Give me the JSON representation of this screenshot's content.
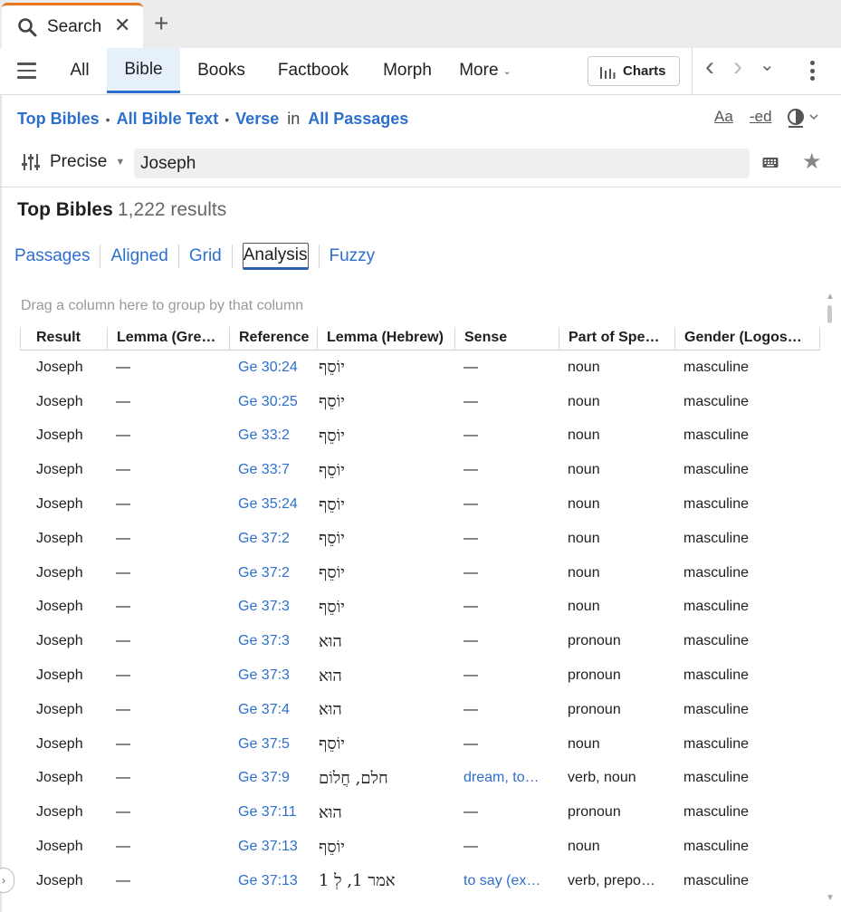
{
  "tab": {
    "title": "Search",
    "close": "✕",
    "new_tab": "+"
  },
  "toolbar": {
    "tabs": [
      {
        "label": "All",
        "active": false
      },
      {
        "label": "Bible",
        "active": true
      },
      {
        "label": "Books",
        "active": false
      },
      {
        "label": "Factbook",
        "active": false
      },
      {
        "label": "Morph",
        "active": false
      },
      {
        "label": "More",
        "active": false
      }
    ],
    "charts_label": "Charts",
    "back": "‹",
    "forward": "›",
    "history_chevron": "⌄"
  },
  "scope": {
    "bibles": "Top Bibles",
    "text": "All Bible Text",
    "unit": "Verse",
    "in": "in",
    "range": "All Passages",
    "dot": "•"
  },
  "tools": {
    "font": "Aa",
    "ed": "-ed"
  },
  "search": {
    "mode": "Precise",
    "query": "Joseph"
  },
  "results": {
    "title": "Top Bibles",
    "count": "1,222 results"
  },
  "views": [
    "Passages",
    "Aligned",
    "Grid",
    "Analysis",
    "Fuzzy"
  ],
  "active_view": "Analysis",
  "group_hint": "Drag a column here to group by that column",
  "columns": [
    "Result",
    "Lemma (Gre…",
    "Reference",
    "Lemma (Hebrew)",
    "Sense",
    "Part of Spe…",
    "Gender (Logos…"
  ],
  "rows": [
    {
      "result": "Joseph",
      "greek": "—",
      "ref": "Ge 30:24",
      "hebrew": "יוֹסֵף",
      "sense": "—",
      "sense_link": false,
      "pos": "noun",
      "gender": "masculine"
    },
    {
      "result": "Joseph",
      "greek": "—",
      "ref": "Ge 30:25",
      "hebrew": "יוֹסֵף",
      "sense": "—",
      "sense_link": false,
      "pos": "noun",
      "gender": "masculine"
    },
    {
      "result": "Joseph",
      "greek": "—",
      "ref": "Ge 33:2",
      "hebrew": "יוֹסֵף",
      "sense": "—",
      "sense_link": false,
      "pos": "noun",
      "gender": "masculine"
    },
    {
      "result": "Joseph",
      "greek": "—",
      "ref": "Ge 33:7",
      "hebrew": "יוֹסֵף",
      "sense": "—",
      "sense_link": false,
      "pos": "noun",
      "gender": "masculine"
    },
    {
      "result": "Joseph",
      "greek": "—",
      "ref": "Ge 35:24",
      "hebrew": "יוֹסֵף",
      "sense": "—",
      "sense_link": false,
      "pos": "noun",
      "gender": "masculine"
    },
    {
      "result": "Joseph",
      "greek": "—",
      "ref": "Ge 37:2",
      "hebrew": "יוֹסֵף",
      "sense": "—",
      "sense_link": false,
      "pos": "noun",
      "gender": "masculine"
    },
    {
      "result": "Joseph",
      "greek": "—",
      "ref": "Ge 37:2",
      "hebrew": "יוֹסֵף",
      "sense": "—",
      "sense_link": false,
      "pos": "noun",
      "gender": "masculine"
    },
    {
      "result": "Joseph",
      "greek": "—",
      "ref": "Ge 37:3",
      "hebrew": "יוֹסֵף",
      "sense": "—",
      "sense_link": false,
      "pos": "noun",
      "gender": "masculine"
    },
    {
      "result": "Joseph",
      "greek": "—",
      "ref": "Ge 37:3",
      "hebrew": "הוּא",
      "sense": "—",
      "sense_link": false,
      "pos": "pronoun",
      "gender": "masculine"
    },
    {
      "result": "Joseph",
      "greek": "—",
      "ref": "Ge 37:3",
      "hebrew": "הוּא",
      "sense": "—",
      "sense_link": false,
      "pos": "pronoun",
      "gender": "masculine"
    },
    {
      "result": "Joseph",
      "greek": "—",
      "ref": "Ge 37:4",
      "hebrew": "הוּא",
      "sense": "—",
      "sense_link": false,
      "pos": "pronoun",
      "gender": "masculine"
    },
    {
      "result": "Joseph",
      "greek": "—",
      "ref": "Ge 37:5",
      "hebrew": "יוֹסֵף",
      "sense": "—",
      "sense_link": false,
      "pos": "noun",
      "gender": "masculine"
    },
    {
      "result": "Joseph",
      "greek": "—",
      "ref": "Ge 37:9",
      "hebrew": "חלם, חֲלוֹם",
      "sense": "dream, to…",
      "sense_link": true,
      "pos": "verb, noun",
      "gender": "masculine"
    },
    {
      "result": "Joseph",
      "greek": "—",
      "ref": "Ge 37:11",
      "hebrew": "הוּא",
      "sense": "—",
      "sense_link": false,
      "pos": "pronoun",
      "gender": "masculine"
    },
    {
      "result": "Joseph",
      "greek": "—",
      "ref": "Ge 37:13",
      "hebrew": "יוֹסֵף",
      "sense": "—",
      "sense_link": false,
      "pos": "noun",
      "gender": "masculine"
    },
    {
      "result": "Joseph",
      "greek": "—",
      "ref": "Ge 37:13",
      "hebrew": "אמר 1, לְ 1",
      "sense": "to say (ex…",
      "sense_link": true,
      "pos": "verb, prepo…",
      "gender": "masculine"
    }
  ],
  "colors": {
    "accent": "#2d6fcc",
    "tab_top": "#e87722",
    "active_bg": "#e6f0fa"
  },
  "icons": [
    "search-icon",
    "close-icon",
    "plus-icon",
    "menu-icon",
    "chevron-down-icon",
    "bar-chart-icon",
    "back-icon",
    "forward-icon",
    "more-vert-icon",
    "text-size-icon",
    "inflection-icon",
    "contrast-icon",
    "sliders-icon",
    "keyboard-icon",
    "star-icon"
  ]
}
